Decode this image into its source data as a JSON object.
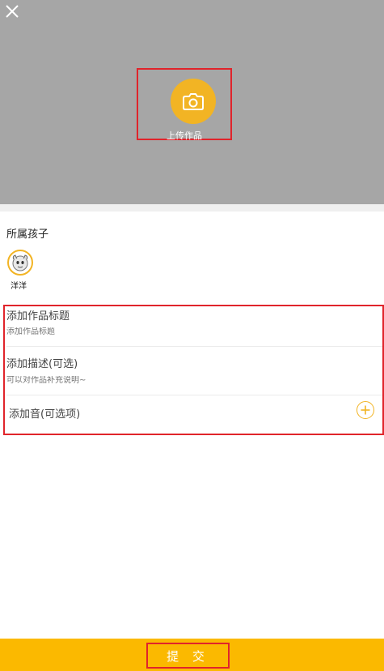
{
  "upload": {
    "label": "上传作品"
  },
  "child": {
    "section_title": "所属孩子",
    "name": "洋洋"
  },
  "form": {
    "title_label": "添加作品标题",
    "title_placeholder": "添加作品标题",
    "desc_label": "添加描述(可选)",
    "desc_placeholder": "可以对作品补充说明~",
    "audio_label": "添加音(可选项)"
  },
  "footer": {
    "submit_label": "提 交"
  },
  "colors": {
    "accent": "#f2b424",
    "submit_bar": "#fbb900",
    "cover_bg": "#a6a6a6"
  },
  "icons": {
    "close": "close-icon",
    "camera": "camera-icon",
    "add": "plus-circle-icon"
  }
}
